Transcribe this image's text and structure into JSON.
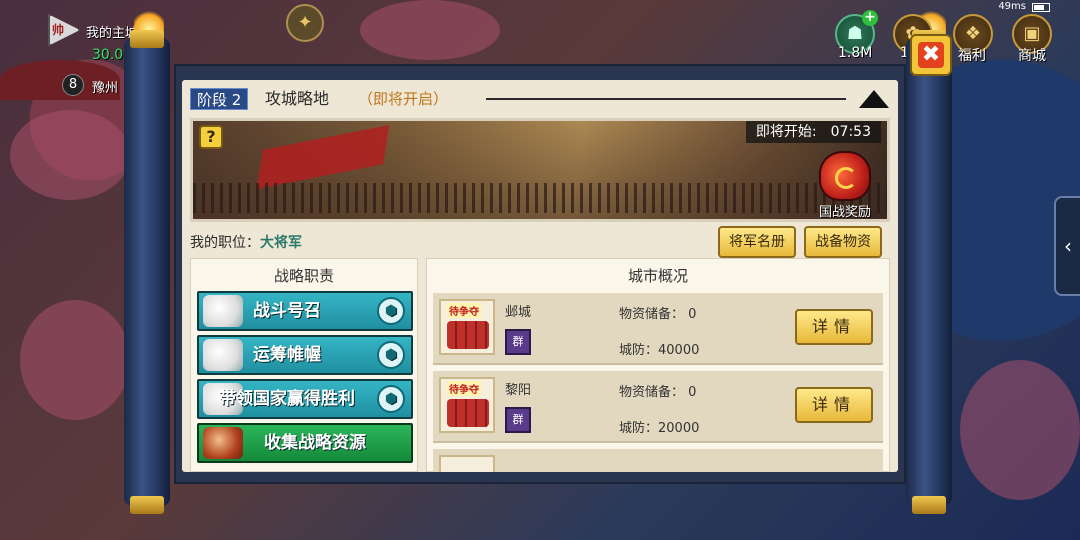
{
  "hud": {
    "flag_text": "帅",
    "territory_label": "我的主城",
    "territory_pct": "30.0%",
    "level": "8",
    "region": "豫州",
    "wheat_icon": "wheat-icon"
  },
  "status_bar": {
    "ping": "49ms"
  },
  "top_right": {
    "jade_value": "1.8M",
    "partial_label": "1",
    "welfare_label": "福利",
    "shop_label": "商城"
  },
  "stage": {
    "badge": "阶段 2",
    "title": "攻城略地",
    "status": "（即将开启）"
  },
  "banner": {
    "countdown_label": "即将开始:",
    "countdown_time": "07:53",
    "reward_label": "国战奖励"
  },
  "position": {
    "label": "我的职位：",
    "value": "大将军"
  },
  "buttons": {
    "generals_roster": "将军名册",
    "war_supplies": "战备物资"
  },
  "strategy": {
    "title": "战略职责",
    "duties": [
      {
        "label": "战斗号召",
        "rank": "⬢"
      },
      {
        "label": "运筹帷幄",
        "rank": "⬢"
      },
      {
        "label": "带领国家赢得胜利",
        "rank": "⬢"
      },
      {
        "label": "收集战略资源"
      }
    ]
  },
  "cities": {
    "title": "城市概况",
    "rows": [
      {
        "tag": "待争夺",
        "name": "邺城",
        "faction": "群",
        "supply": "物资储备：  0",
        "defense": "城防：40000",
        "button": "详情"
      },
      {
        "tag": "待争夺",
        "name": "黎阳",
        "faction": "群",
        "supply": "物资储备：  0",
        "defense": "城防：20000",
        "button": "详情"
      }
    ]
  },
  "colors": {
    "accent_blue": "#2a4a86",
    "status_orange": "#c0761a",
    "position_teal": "#2c7a6a",
    "duty_teal": "#1f8fa0",
    "duty_green": "#158a3a",
    "button_gold": "#e7b83a",
    "close_red": "#e3421e"
  }
}
